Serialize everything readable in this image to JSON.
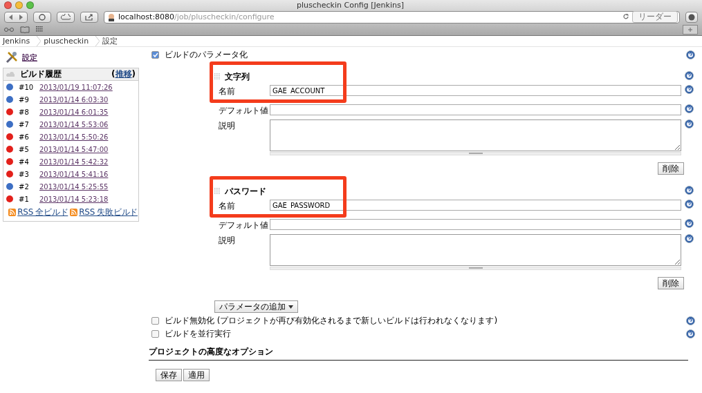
{
  "window": {
    "title": "pluscheckin Config [Jenkins]"
  },
  "address_bar": {
    "host": "localhost:8080",
    "path": "/job/pluscheckin/configure",
    "reader_button": "リーダー"
  },
  "breadcrumbs": [
    "Jenkins",
    "pluscheckin",
    "設定"
  ],
  "sidebar": {
    "settings_link": "設定",
    "build_history": {
      "title": "ビルド履歴",
      "trend_open": "(",
      "trend_link": "推移",
      "trend_close": ")",
      "builds": [
        {
          "number": "#10",
          "date": "2013/01/19 11:07:26",
          "color": "#3d6fc4"
        },
        {
          "number": "#9",
          "date": "2013/01/14 6:03:30",
          "color": "#3d6fc4"
        },
        {
          "number": "#8",
          "date": "2013/01/14 6:01:35",
          "color": "#e3201b"
        },
        {
          "number": "#7",
          "date": "2013/01/14 5:53:06",
          "color": "#3d6fc4"
        },
        {
          "number": "#6",
          "date": "2013/01/14 5:50:26",
          "color": "#e3201b"
        },
        {
          "number": "#5",
          "date": "2013/01/14 5:47:00",
          "color": "#e3201b"
        },
        {
          "number": "#4",
          "date": "2013/01/14 5:42:32",
          "color": "#e3201b"
        },
        {
          "number": "#3",
          "date": "2013/01/14 5:41:16",
          "color": "#e3201b"
        },
        {
          "number": "#2",
          "date": "2013/01/14 5:25:55",
          "color": "#3d6fc4"
        },
        {
          "number": "#1",
          "date": "2013/01/14 5:23:18",
          "color": "#e3201b"
        }
      ],
      "rss_links": [
        "RSS 全ビルド",
        "RSS 失敗ビルド"
      ]
    }
  },
  "main": {
    "parameterize": {
      "label": "ビルドのパラメータ化",
      "checked": true
    },
    "parameters": [
      {
        "type": "文字列",
        "highlighted": true,
        "name_label": "名前",
        "name_value": "GAE_ACCOUNT",
        "default_label": "デフォルト値",
        "description_label": "説明",
        "delete_button": "削除"
      },
      {
        "type": "パスワード",
        "highlighted": true,
        "name_label": "名前",
        "name_value": "GAE_PASSWORD",
        "default_label": "デフォルト値",
        "description_label": "説明",
        "delete_button": "削除"
      }
    ],
    "add_parameter_button": "パラメータの追加",
    "options": [
      {
        "label": "ビルド無効化 (プロジェクトが再び有効化されるまで新しいビルドは行われなくなります)",
        "checked": false
      },
      {
        "label": "ビルドを並行実行",
        "checked": false
      }
    ],
    "advanced_section_title": "プロジェクトの高度なオプション",
    "buttons": [
      "保存",
      "適用"
    ]
  }
}
